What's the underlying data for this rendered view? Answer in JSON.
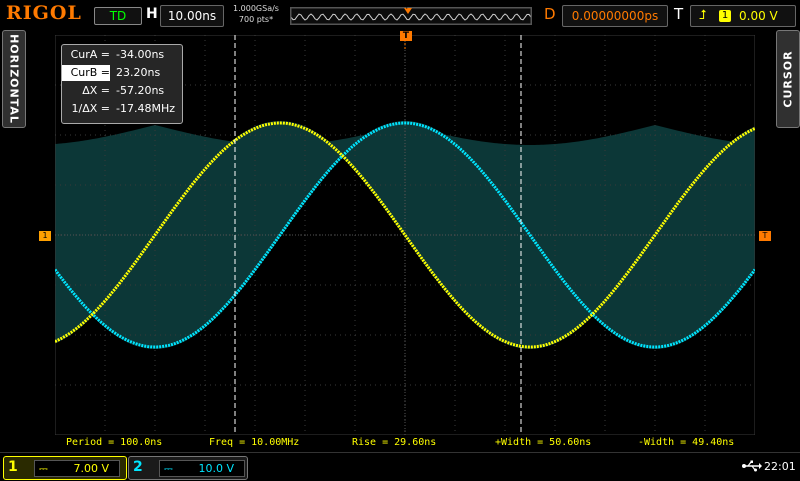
{
  "header": {
    "brand": "RIGOL",
    "run_state": "TD",
    "timebase_label": "H",
    "timebase": "10.00ns",
    "sample_rate": "1.000GSa/s",
    "mem_depth": "700 pts*",
    "trig_pos_marker": "T",
    "delay_label": "D",
    "delay": "0.00000000ps",
    "trigger_label": "T",
    "trigger_source": "1",
    "trigger_edge_icon": "rising-edge-icon",
    "trigger_level": "0.00 V"
  },
  "side_tabs": {
    "left": "HORIZONTAL",
    "right": "CURSOR"
  },
  "cursor_panel": {
    "rows": [
      {
        "label": "CurA =",
        "value": "-34.00ns",
        "selected": false
      },
      {
        "label": "CurB =",
        "value": "23.20ns",
        "selected": true
      },
      {
        "label": "ΔX =",
        "value": "-57.20ns",
        "selected": false
      },
      {
        "label": "1/ΔX =",
        "value": "-17.48MHz",
        "selected": false
      }
    ]
  },
  "markers": {
    "ch1_offset": "1",
    "trigger_level": "T",
    "trigger_position": "T"
  },
  "measurements": [
    {
      "text": "Period = 100.0ns"
    },
    {
      "text": "Freq = 10.00MHz"
    },
    {
      "text": "Rise = 29.60ns"
    },
    {
      "text": "+Width = 50.60ns"
    },
    {
      "text": "-Width = 49.40ns"
    }
  ],
  "channels": [
    {
      "number": "1",
      "coupling": "⎓",
      "scale": "7.00 V",
      "color": "#ffff00"
    },
    {
      "number": "2",
      "coupling": "⎓",
      "scale": "10.0 V",
      "color": "#00e5ff"
    }
  ],
  "status": {
    "usb_icon": "usb-icon",
    "time": "22:01"
  },
  "colors": {
    "ch1": "#ffff00",
    "ch2": "#00e5ff",
    "persistence": "#0d3a3a",
    "accent": "#ff7a00"
  },
  "waveforms": {
    "period_ns": 100,
    "time_per_div_ns": 10,
    "ch1_phase_deg": 90,
    "ch2_phase_deg": 0
  }
}
